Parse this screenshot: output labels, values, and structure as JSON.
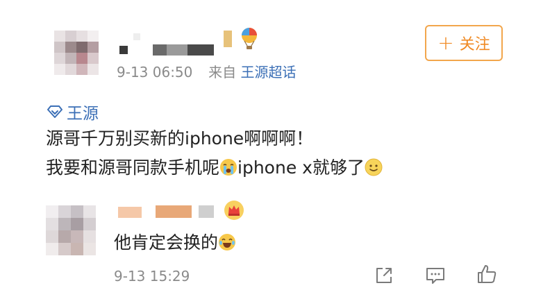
{
  "post": {
    "timestamp": "9-13 06:50",
    "source_prefix": "来自",
    "source_name": "王源超话",
    "follow_button": {
      "icon": "plus-icon",
      "label": "关注",
      "color": "#f08a24"
    },
    "topic_tag": {
      "icon": "super-topic-diamond-icon",
      "label": "王源"
    },
    "content_line1": "源哥千万别买新的iphone啊啊啊！",
    "content_line2_text": "我要和源哥同款手机呢",
    "content_line2_emoji": "crying-face-emoji",
    "content_line2_text2": "iphone x就够了",
    "content_line2_emoji2": "smile-face-emoji",
    "username_badge": "hot-air-balloon-icon",
    "link_color": "#3b6fb6"
  },
  "reply": {
    "text": "他肯定会换的",
    "text_emoji": "laughing-tears-emoji",
    "timestamp": "9-13 15:29",
    "username_badge": "crown-badge-icon",
    "actions": [
      {
        "name": "share-icon"
      },
      {
        "name": "comment-icon"
      },
      {
        "name": "like-thumb-icon"
      }
    ]
  }
}
